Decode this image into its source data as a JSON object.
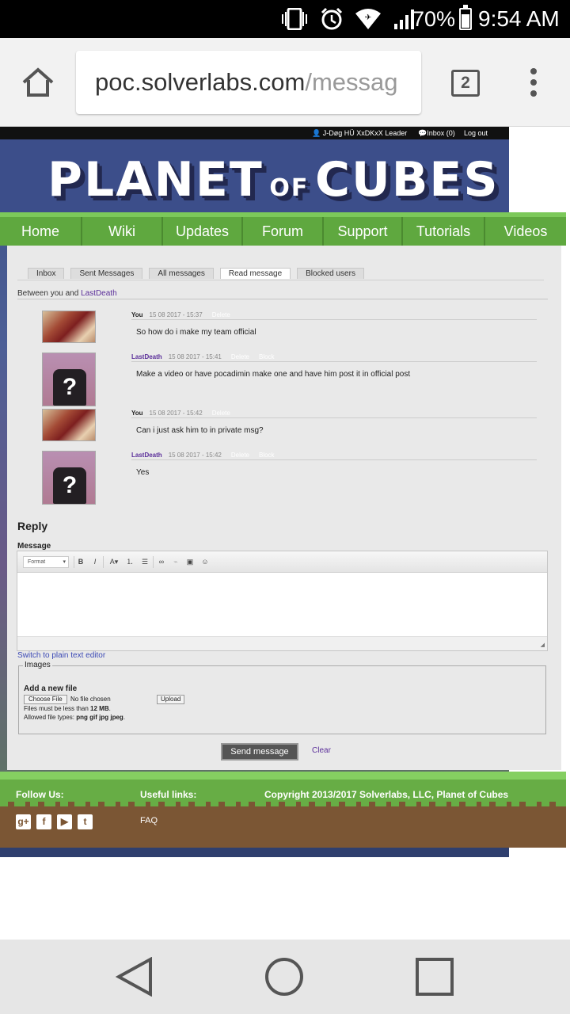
{
  "status_bar": {
    "battery": "70%",
    "time": "9:54 AM"
  },
  "browser": {
    "url_host": "poc.solverlabs.com",
    "url_path": "/messag",
    "tab_count": "2"
  },
  "site": {
    "topbar": {
      "user": "J-Døg HÜ XxDKxX Leader",
      "inbox": "Inbox (0)",
      "logout": "Log out"
    },
    "logo": {
      "word1": "PLANET",
      "word2": "OF",
      "word3": "CUBES"
    },
    "nav": [
      "Home",
      "Wiki",
      "Updates",
      "Forum",
      "Support",
      "Tutorials",
      "Videos"
    ]
  },
  "messages_page": {
    "tabs": [
      "Inbox",
      "Sent Messages",
      "All messages",
      "Read message",
      "Blocked users"
    ],
    "active_tab": "Read message",
    "between_prefix": "Between you and",
    "between_user": "LastDeath",
    "messages": [
      {
        "author": "You",
        "time": "15 08 2017 - 15:37",
        "actions": [
          "Delete"
        ],
        "body": "So how do i make my team official"
      },
      {
        "author": "LastDeath",
        "time": "15 08 2017 - 15:41",
        "actions": [
          "Delete",
          "Block"
        ],
        "body": "Make a video or have pocadimin make one and have him post it in official post"
      },
      {
        "author": "You",
        "time": "15 08 2017 - 15:42",
        "actions": [
          "Delete"
        ],
        "body": "Can i just ask him to in private msg?"
      },
      {
        "author": "LastDeath",
        "time": "15 08 2017 - 15:42",
        "actions": [
          "Delete",
          "Block"
        ],
        "body": "Yes"
      }
    ],
    "reply": {
      "title": "Reply",
      "message_label": "Message",
      "format_label": "Format",
      "plain_text_link": "Switch to plain text editor",
      "images_legend": "Images",
      "add_new_file": "Add a new file",
      "choose_file": "Choose File",
      "no_file": "No file chosen",
      "upload": "Upload",
      "size_limit_prefix": "Files must be less than",
      "size_limit_value": "12 MB",
      "types_prefix": "Allowed file types:",
      "types_value": "png gif jpg jpeg",
      "send": "Send message",
      "clear": "Clear"
    }
  },
  "footer": {
    "follow": "Follow Us:",
    "useful": "Useful links:",
    "faq": "FAQ",
    "copyright": "Copyright 2013/2017 Solverlabs, LLC, Planet of Cubes",
    "social_icons": [
      "google-plus",
      "facebook",
      "youtube",
      "twitter"
    ]
  },
  "colors": {
    "grass": "#5fa83f",
    "dirt": "#7b5634",
    "link_purple": "#5b2f9a",
    "banner_blue": "#3c4e8a"
  }
}
